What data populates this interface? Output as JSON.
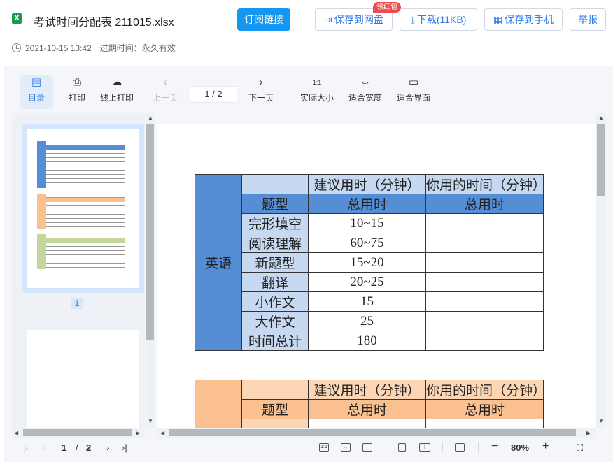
{
  "header": {
    "file_icon": "excel-file-icon",
    "file_icon_glyph": "X",
    "title": "考试时间分配表 211015.xlsx",
    "subscribe_label": "订阅链接",
    "save_disk_label": "保存到网盘",
    "red_packet": "领红包",
    "download_label": "下载(11KB)",
    "save_phone_label": "保存到手机",
    "report_label": "举报",
    "date": "2021-10-15 13:42",
    "expire_label": "过期时间：永久有效"
  },
  "toolbar": {
    "toc": "目录",
    "print": "打印",
    "online_print": "线上打印",
    "prev": "上一页",
    "page_indicator": "1  /  2",
    "next": "下一页",
    "actual_size": "实际大小",
    "fit_width": "适合宽度",
    "fit_page": "适合界面",
    "actual_size_icon_text": "1:1"
  },
  "thumbnails": {
    "current_page": "1"
  },
  "tables": [
    {
      "subject": "英语",
      "color_side": "#558ed5",
      "color_head": "#558ed5",
      "color_top": "#c6d9f1",
      "color_label": "#c6d9f1",
      "header_suggest": "建议用时（分钟）",
      "header_yours": "你用的时间（分钟）",
      "col_type": "题型",
      "col_total1": "总用时",
      "col_total2": "总用时",
      "rows": [
        {
          "type": "完形填空",
          "time": "10~15"
        },
        {
          "type": "阅读理解",
          "time": "60~75"
        },
        {
          "type": "新题型",
          "time": "15~20"
        },
        {
          "type": "翻译",
          "time": "20~25"
        },
        {
          "type": "小作文",
          "time": "15"
        },
        {
          "type": "大作文",
          "time": "25"
        },
        {
          "type": "时间总计",
          "time": "180"
        }
      ]
    },
    {
      "color_side": "#fac090",
      "color_head": "#fac090",
      "color_top": "#fcd5b4",
      "header_suggest": "建议用时（分钟）",
      "header_yours": "你用的时间（分钟）",
      "col_type": "题型",
      "col_total1": "总用时",
      "col_total2": "总用时"
    }
  ],
  "statusbar": {
    "page_current": "1",
    "page_sep": "/",
    "page_total": "2",
    "zoom": "80%",
    "zoom_out": "−",
    "zoom_in": "+"
  }
}
